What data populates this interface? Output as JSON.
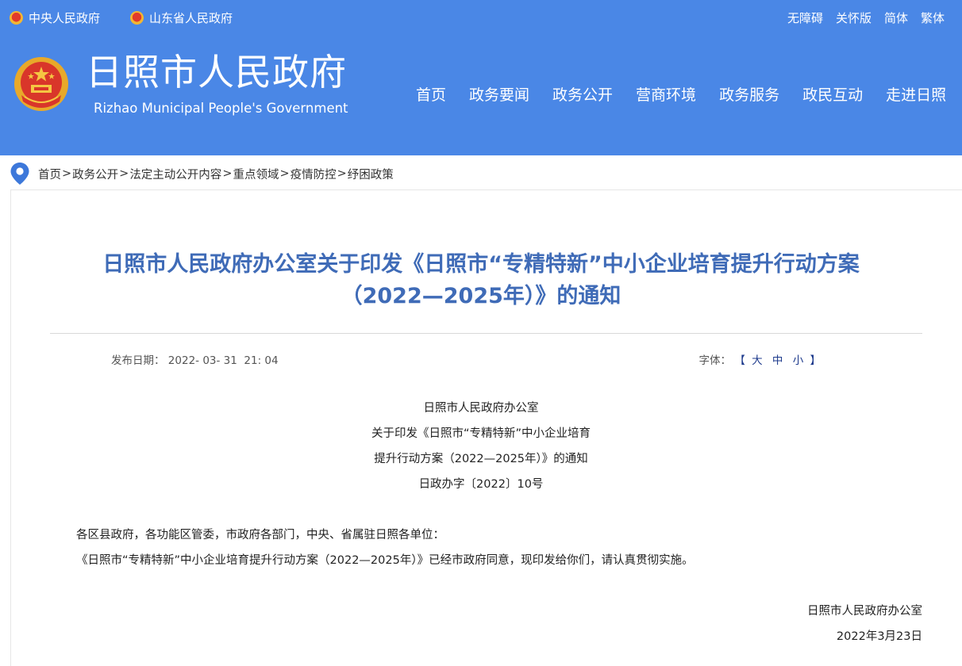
{
  "topbar": {
    "links": [
      "中央人民政府",
      "山东省人民政府"
    ],
    "right_links": [
      "无障碍",
      "关怀版",
      "简体",
      "繁体"
    ]
  },
  "header": {
    "title": "日照市人民政府",
    "subtitle": "Rizhao Municipal People's Government",
    "nav": [
      "首页",
      "政务要闻",
      "政务公开",
      "营商环境",
      "政务服务",
      "政民互动",
      "走进日照"
    ]
  },
  "breadcrumb": {
    "items": [
      "首页",
      "政务公开",
      "法定主动公开内容",
      "重点领域",
      "疫情防控",
      "纾困政策"
    ],
    "separator": ">"
  },
  "article": {
    "title_line1": "日照市人民政府办公室关于印发《日照市“专精特新”中小企业培育提升行动方案",
    "title_line2": "（2022—2025年）》的通知",
    "publish_label": "发布日期：",
    "publish_date": "2022- 03- 31  21: 04",
    "font_label": "字体：",
    "font_open": "【",
    "font_options": [
      "大",
      "中",
      "小"
    ],
    "font_close": "】",
    "doc_header": [
      "日照市人民政府办公室",
      "关于印发《日照市“专精特新”中小企业培育",
      "提升行动方案（2022—2025年）》的通知",
      "日政办字〔2022〕10号"
    ],
    "salutation": "各区县政府，各功能区管委，市政府各部门，中央、省属驻日照各单位：",
    "body": "《日照市“专精特新”中小企业培育提升行动方案（2022—2025年）》已经市政府同意，现印发给你们，请认真贯彻实施。",
    "signature": "日照市人民政府办公室",
    "sign_date": "2022年3月23日"
  },
  "colors": {
    "header_bg": "#4a87e6",
    "title_color": "#3f6bb7",
    "font_option_color": "#1d3a8c"
  }
}
